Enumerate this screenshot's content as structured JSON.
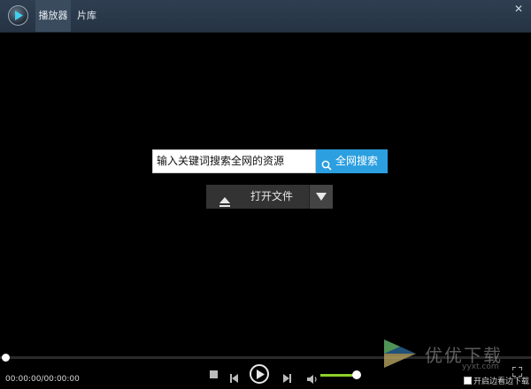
{
  "titlebar": {
    "tabs": [
      {
        "label": "播放器",
        "active": true
      },
      {
        "label": "片库",
        "active": false
      }
    ],
    "close_glyph": "✕"
  },
  "search": {
    "placeholder": "输入关键词搜索全网的资源",
    "button_label": "全网搜索"
  },
  "open_file": {
    "label": "打开文件"
  },
  "playback": {
    "timecode": "00:00:00/00:00:00",
    "progress": 0.0,
    "volume": 0.85
  },
  "options": {
    "download_while_play": "开启边看边下载"
  },
  "watermark": {
    "text": "优优下载",
    "url": "yyxt.com"
  },
  "colors": {
    "accent_blue": "#2b9fe0",
    "volume_green": "#8ed12a",
    "titlebar": "#2f3f51"
  }
}
